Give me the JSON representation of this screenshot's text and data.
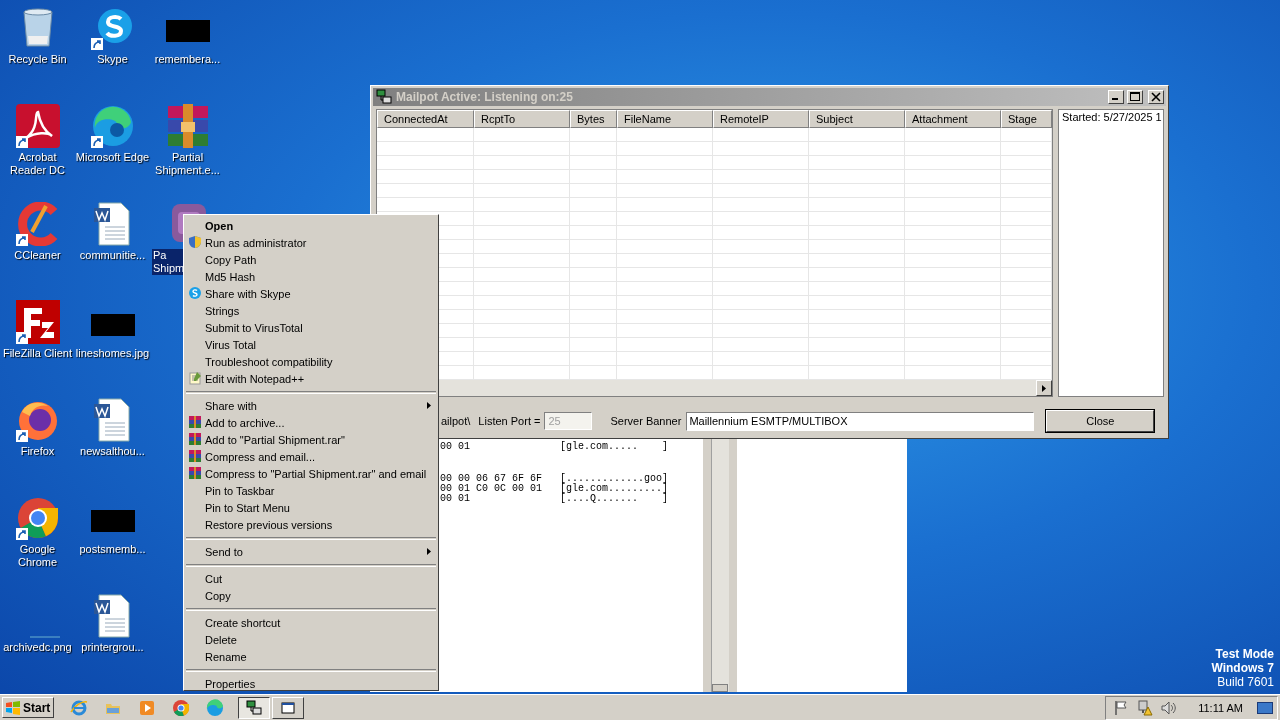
{
  "desktop": {
    "icons": [
      {
        "label": "Recycle Bin",
        "kind": "recycle",
        "shortcut": false,
        "selected": false
      },
      {
        "label": "Acrobat Reader DC",
        "kind": "acrobat",
        "shortcut": true,
        "selected": false
      },
      {
        "label": "CCleaner",
        "kind": "ccleaner",
        "shortcut": true,
        "selected": false
      },
      {
        "label": "FileZilla Client",
        "kind": "filezilla",
        "shortcut": true,
        "selected": false
      },
      {
        "label": "Firefox",
        "kind": "firefox",
        "shortcut": true,
        "selected": false
      },
      {
        "label": "Google Chrome",
        "kind": "chrome",
        "shortcut": true,
        "selected": false
      },
      {
        "label": "archivedc.png",
        "kind": "blank",
        "shortcut": false,
        "selected": false
      },
      {
        "label": "Skype",
        "kind": "skype",
        "shortcut": true,
        "selected": false
      },
      {
        "label": "Microsoft Edge",
        "kind": "edge",
        "shortcut": true,
        "selected": false
      },
      {
        "label": "communitie...",
        "kind": "word",
        "shortcut": false,
        "selected": false
      },
      {
        "label": "lineshomes.jpg",
        "kind": "thumb",
        "shortcut": false,
        "selected": false
      },
      {
        "label": "newsalthou...",
        "kind": "word",
        "shortcut": false,
        "selected": false
      },
      {
        "label": "postsmemb...",
        "kind": "thumb",
        "shortcut": false,
        "selected": false
      },
      {
        "label": "printergrou...",
        "kind": "word",
        "shortcut": false,
        "selected": false
      },
      {
        "label": "remembera...",
        "kind": "thumb",
        "shortcut": false,
        "selected": false
      },
      {
        "label": "Partial Shipment.e...",
        "kind": "winrar",
        "shortcut": false,
        "selected": false
      },
      {
        "label": "Pa Shipm",
        "kind": "app",
        "shortcut": false,
        "selected": true
      }
    ],
    "os_watermark": [
      "Test Mode",
      "Windows 7",
      "Build 7601"
    ]
  },
  "hex_window": {
    "blocks": [
      [
        {
          "bytes": "00 01",
          "ascii": "[gle.com.....    ]"
        }
      ],
      [
        {
          "bytes": "00 00 06 67 6F 6F",
          "ascii": "[.............goo]"
        },
        {
          "bytes": "00 01 C0 0C 00 01",
          "ascii": "[gle.com.........]"
        },
        {
          "bytes": "00 01",
          "ascii": "[....Q.......    ]"
        }
      ]
    ]
  },
  "mailpot_window": {
    "title": "Mailpot Active: Listening on:25",
    "active": false,
    "table": {
      "columns": [
        "ConnectedAt",
        "RcptTo",
        "Bytes",
        "FileName",
        "RemoteIP",
        "Subject",
        "Attachment",
        "Stage"
      ]
    },
    "log": [
      "Started: 5/27/2025 1"
    ],
    "path": "ailpot\\",
    "listen_port": {
      "label": "Listen Port =",
      "value": "25",
      "disabled": true
    },
    "server_banner": {
      "label": "Server Banner",
      "value": "Maillennium ESMTP/MULTIBOX"
    },
    "close_button": "Close"
  },
  "context_menu": {
    "groups": [
      [
        {
          "label": "Open",
          "kind": "default"
        },
        {
          "label": "Run as administrator",
          "kind": "shield"
        },
        {
          "label": "Copy Path",
          "kind": "plain"
        },
        {
          "label": "Md5 Hash",
          "kind": "plain"
        },
        {
          "label": "Share with Skype",
          "kind": "skype"
        },
        {
          "label": "Strings",
          "kind": "plain"
        },
        {
          "label": "Submit to VirusTotal",
          "kind": "plain"
        },
        {
          "label": "Virus Total",
          "kind": "plain"
        },
        {
          "label": "Troubleshoot compatibility",
          "kind": "plain"
        },
        {
          "label": "Edit with Notepad++",
          "kind": "notepad"
        }
      ],
      [
        {
          "label": "Share with",
          "kind": "submenu"
        },
        {
          "label": "Add to archive...",
          "kind": "archive"
        },
        {
          "label": "Add to \"Partial Shipment.rar\"",
          "kind": "archive"
        },
        {
          "label": "Compress and email...",
          "kind": "archive"
        },
        {
          "label": "Compress to \"Partial Shipment.rar\" and email",
          "kind": "archive"
        },
        {
          "label": "Pin to Taskbar",
          "kind": "plain"
        },
        {
          "label": "Pin to Start Menu",
          "kind": "plain"
        },
        {
          "label": "Restore previous versions",
          "kind": "plain"
        }
      ],
      [
        {
          "label": "Send to",
          "kind": "submenu"
        }
      ],
      [
        {
          "label": "Cut",
          "kind": "plain"
        },
        {
          "label": "Copy",
          "kind": "plain"
        }
      ],
      [
        {
          "label": "Create shortcut",
          "kind": "plain"
        },
        {
          "label": "Delete",
          "kind": "plain"
        },
        {
          "label": "Rename",
          "kind": "plain"
        }
      ],
      [
        {
          "label": "Properties",
          "kind": "plain"
        }
      ]
    ]
  },
  "taskbar": {
    "start": "Start",
    "quick_launch": [
      {
        "kind": "ie"
      },
      {
        "kind": "explorer"
      },
      {
        "kind": "media"
      },
      {
        "kind": "chrome"
      },
      {
        "kind": "edge"
      }
    ],
    "tasks": [
      {
        "kind": "mailpot",
        "selected": true
      },
      {
        "kind": "window",
        "selected": false
      }
    ],
    "tray": [
      {
        "kind": "flag"
      },
      {
        "kind": "network"
      },
      {
        "kind": "speaker"
      }
    ],
    "clock": "11:11 AM"
  }
}
